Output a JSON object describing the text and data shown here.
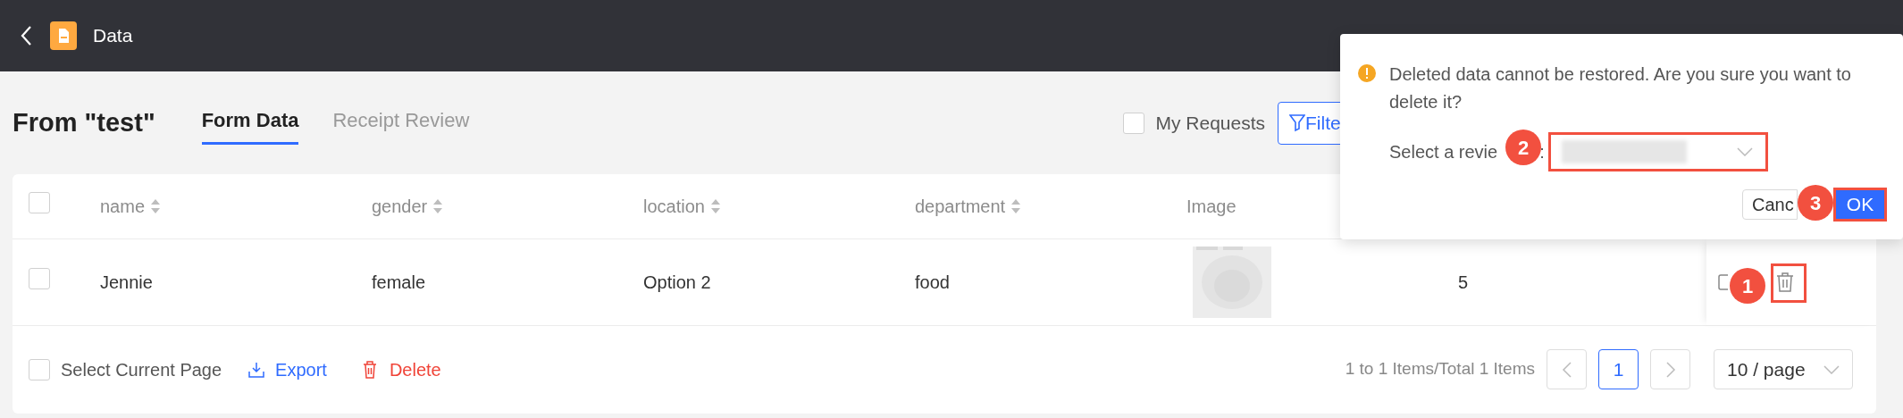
{
  "header": {
    "title": "Data"
  },
  "page_title": "From \"test\"",
  "tabs": [
    {
      "label": "Form Data",
      "selected": true
    },
    {
      "label": "Receipt Review",
      "selected": false
    }
  ],
  "toolbar": {
    "my_requests": {
      "label": "My Requests",
      "checked": false
    },
    "filter_button": "Filte"
  },
  "table": {
    "header_checked": false,
    "columns": [
      {
        "label": "name",
        "sortable": true
      },
      {
        "label": "gender",
        "sortable": true
      },
      {
        "label": "location",
        "sortable": true
      },
      {
        "label": "department",
        "sortable": true
      },
      {
        "label": "Image",
        "sortable": false
      }
    ],
    "rows": [
      {
        "checked": false,
        "cells": [
          {
            "kind": "text",
            "text": "Jennie"
          },
          {
            "kind": "text",
            "text": "female"
          },
          {
            "kind": "text",
            "text": "Option 2"
          },
          {
            "kind": "text",
            "text": "food"
          },
          {
            "kind": "picture"
          },
          {
            "kind": "text",
            "text": "5"
          }
        ]
      }
    ]
  },
  "footer": {
    "select_current_page": {
      "label": "Select Current Page",
      "checked": false
    },
    "export": "Export",
    "delete": "Delete",
    "pagination": {
      "summary": "1 to 1 Items/Total 1 Items",
      "pages": [
        {
          "label": "1",
          "selected": true
        }
      ],
      "page_size": "10 / page"
    }
  },
  "popover": {
    "message": "Deleted data cannot be restored. Are you sure you want to delete it?",
    "reviewer_label": "Select a revie",
    "colon": ":",
    "cancel": "Canc",
    "ok": "OK"
  },
  "callouts": [
    {
      "label": "1"
    },
    {
      "label": "2"
    },
    {
      "label": "3"
    }
  ]
}
